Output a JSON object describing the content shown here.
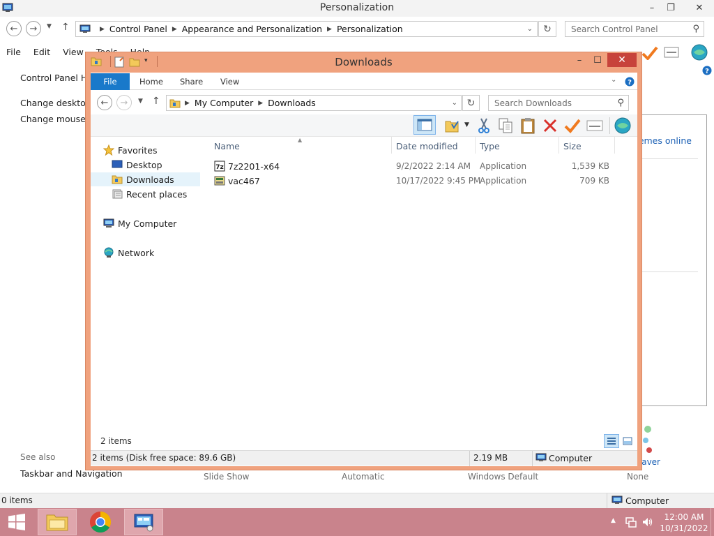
{
  "control_panel": {
    "title": "Personalization",
    "breadcrumb": [
      "Control Panel",
      "Appearance and Personalization",
      "Personalization"
    ],
    "search_placeholder": "Search Control Panel",
    "menu": [
      "File",
      "Edit",
      "View",
      "Tools",
      "Help"
    ],
    "sidebar_links": [
      "Control Panel Home",
      "Change desktop icons",
      "Change mouse pointers"
    ],
    "themes_online_link": "Get more themes online",
    "see_also_label": "See also",
    "see_also_links": [
      "Taskbar and Navigation"
    ],
    "theme_settings": [
      {
        "label": "Slide Show"
      },
      {
        "label": "Automatic"
      },
      {
        "label": "Windows Default"
      },
      {
        "label": "None"
      }
    ],
    "screen_saver_label": "Screen Saver",
    "status_left": "0 items",
    "status_right": "Computer"
  },
  "explorer": {
    "title": "Downloads",
    "ribbon_tabs": [
      "File",
      "Home",
      "Share",
      "View"
    ],
    "breadcrumb": [
      "My Computer",
      "Downloads"
    ],
    "search_placeholder": "Search Downloads",
    "nav": {
      "favorites": "Favorites",
      "favorites_items": [
        "Desktop",
        "Downloads",
        "Recent places"
      ],
      "computer": "My Computer",
      "network": "Network"
    },
    "columns": [
      "Name",
      "Date modified",
      "Type",
      "Size"
    ],
    "files": [
      {
        "name": "7z2201-x64",
        "date": "9/2/2022 2:14 AM",
        "type": "Application",
        "size": "1,539 KB",
        "icon": "7zip-installer-icon"
      },
      {
        "name": "vac467",
        "date": "10/17/2022 9:45 PM",
        "type": "Application",
        "size": "709 KB",
        "icon": "application-installer-icon"
      }
    ],
    "item_count": "2 items",
    "status_left": "2 items (Disk free space: 89.6 GB)",
    "status_size": "2.19 MB",
    "status_location": "Computer"
  },
  "taskbar": {
    "time": "12:00 AM",
    "date": "10/31/2022",
    "pinned": [
      "file-explorer-icon",
      "chrome-icon",
      "control-panel-icon"
    ]
  },
  "colors": {
    "explorer_frame": "#f0a27e",
    "close_button": "#c7433b",
    "file_tab": "#1979ca",
    "taskbar": "#c9838c",
    "selection": "#e5f3fb"
  }
}
